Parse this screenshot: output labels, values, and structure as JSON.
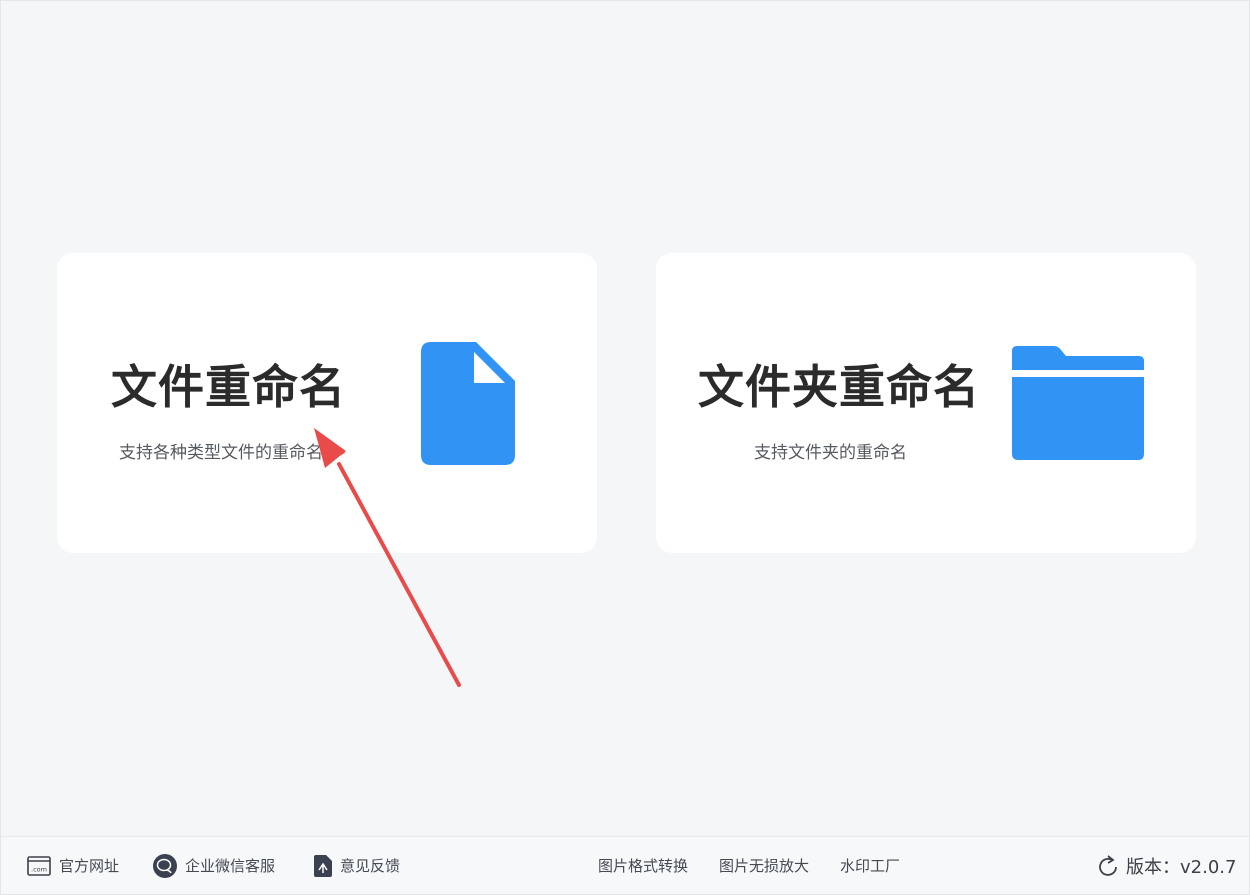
{
  "cards": [
    {
      "title": "文件重命名",
      "description": "支持各种类型文件的重命名",
      "icon": "file-icon",
      "icon_color": "#3194f4"
    },
    {
      "title": "文件夹重命名",
      "description": "支持文件夹的重命名",
      "icon": "folder-icon",
      "icon_color": "#3194f4"
    }
  ],
  "annotation": {
    "icon": "red-arrow-icon",
    "color": "#e94b4b"
  },
  "footer": {
    "official_site": {
      "label": "官方网址",
      "icon": "website-icon",
      "icon_text": ".com"
    },
    "wechat_service": {
      "label": "企业微信客服",
      "icon": "wechat-chat-icon"
    },
    "feedback": {
      "label": "意见反馈",
      "icon": "feedback-icon"
    },
    "image_format": {
      "label": "图片格式转换"
    },
    "image_upscale": {
      "label": "图片无损放大"
    },
    "watermark_factory": {
      "label": "水印工厂"
    },
    "version": {
      "label": "版本：v2.0.7",
      "icon": "refresh-icon"
    }
  }
}
